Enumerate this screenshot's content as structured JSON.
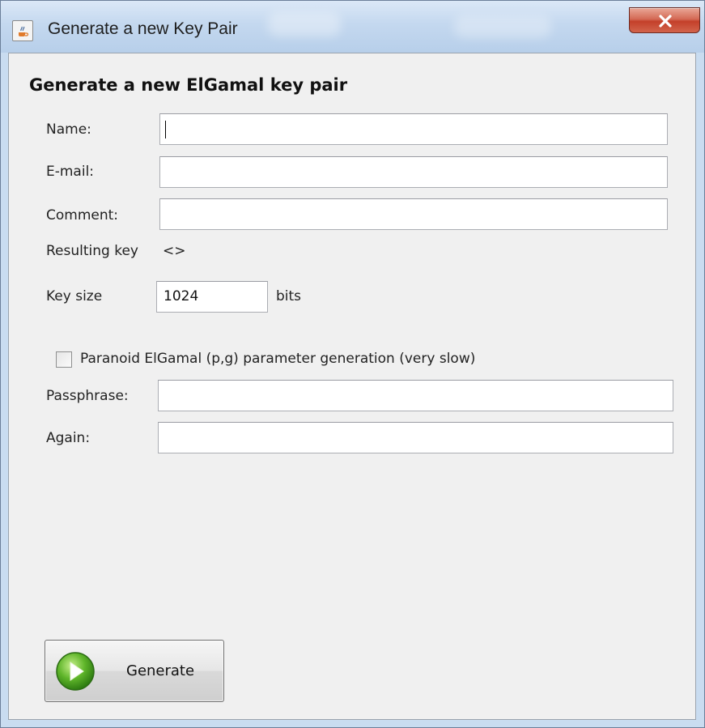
{
  "window": {
    "title": "Generate a new Key Pair"
  },
  "form": {
    "heading": "Generate a new ElGamal key pair",
    "name_label": "Name:",
    "name_value": "",
    "email_label": "E-mail:",
    "email_value": "",
    "comment_label": "Comment:",
    "comment_value": "",
    "resulting_key_label": "Resulting key",
    "resulting_key_value": "<>",
    "key_size_label": "Key size",
    "key_size_value": "1024",
    "key_size_unit": "bits",
    "paranoid_label": "Paranoid ElGamal (p,g) parameter generation (very slow)",
    "paranoid_checked": false,
    "passphrase_label": "Passphrase:",
    "passphrase_value": "",
    "again_label": "Again:",
    "again_value": ""
  },
  "actions": {
    "generate_label": "Generate"
  },
  "icons": {
    "app": "java-cup-icon",
    "close": "close-icon",
    "generate": "green-play-icon"
  }
}
